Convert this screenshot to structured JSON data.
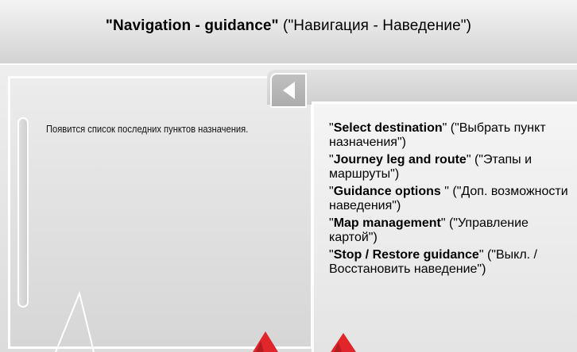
{
  "header": {
    "title_bold": "\"Navigation - guidance\"",
    "title_rest": " (\"Навигация - Наведение\")"
  },
  "left_panel": {
    "message": "Появится список последних пунктов назначения."
  },
  "menu": {
    "items": [
      {
        "q_open": "\"",
        "bold": "Select destination",
        "rest": "\" (\"Выбрать пункт назначения\")"
      },
      {
        "q_open": "\"",
        "bold": "Journey leg and route",
        "rest": "\" (\"Этапы и маршруты\")"
      },
      {
        "q_open": "\"",
        "bold": "Guidance options ",
        "rest": "\" (\"Доп. возможности наведения\")"
      },
      {
        "q_open": "\"",
        "bold": "Map management",
        "rest": "\" (\"Управление картой\")"
      },
      {
        "q_open": "\"",
        "bold": "Stop / Restore guidance",
        "rest": "\" (\"Выкл. / Восстановить наведение\")"
      }
    ]
  },
  "colors": {
    "callout_arrow": "#e0262b",
    "panel_border": "#ffffff"
  },
  "icons": {
    "back": "left-triangle-icon"
  }
}
